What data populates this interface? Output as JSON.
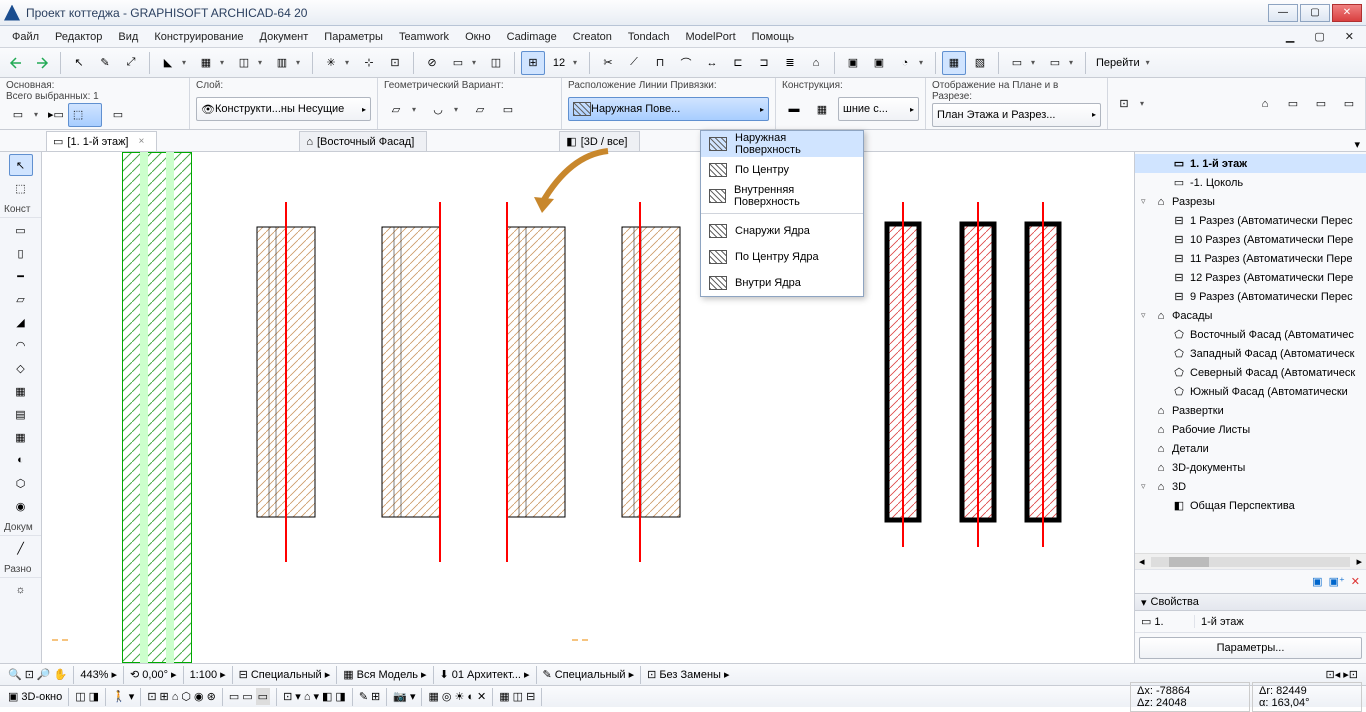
{
  "title": "Проект коттеджа - GRAPHISOFT ARCHICAD-64 20",
  "menu": [
    "Файл",
    "Редактор",
    "Вид",
    "Конструирование",
    "Документ",
    "Параметры",
    "Teamwork",
    "Окно",
    "Cadimage",
    "Creaton",
    "Tondach",
    "ModelPort",
    "Помощь"
  ],
  "goto": "Перейти",
  "infobox": {
    "main_lbl": "Основная:",
    "sel_lbl": "Всего выбранных: 1",
    "layer_lbl": "Слой:",
    "layer_val": "Конструкти...ны Несущие",
    "geom_lbl": "Геометрический Вариант:",
    "refline_lbl": "Расположение Линии Привязки:",
    "refline_val": "Наружная Пове...",
    "constr_lbl": "Конструкция:",
    "constr_val": "шние с...",
    "display_lbl": "Отображение на Плане и в Разрезе:",
    "display_val": "План Этажа и Разрез..."
  },
  "tabs": {
    "t1": "[1. 1-й этаж]",
    "t2": "[Восточный Фасад]",
    "t3": "[3D / все]"
  },
  "toolbox": {
    "hdr1": "Конст",
    "hdr2": "Докум",
    "hdr3": "Разно"
  },
  "popup": {
    "i1": "Наружная Поверхность",
    "i2": "По Центру",
    "i3": "Внутренняя Поверхность",
    "i4": "Снаружи Ядра",
    "i5": "По Центру Ядра",
    "i6": "Внутри Ядра"
  },
  "navigator": {
    "items": [
      {
        "indent": 1,
        "icon": "floor",
        "label": "1. 1-й этаж",
        "sel": true
      },
      {
        "indent": 1,
        "icon": "floor",
        "label": "-1. Цоколь"
      },
      {
        "indent": 0,
        "icon": "group",
        "label": "Разрезы",
        "twist": "▿"
      },
      {
        "indent": 1,
        "icon": "sect",
        "label": "1 Разрез (Автоматически Перес"
      },
      {
        "indent": 1,
        "icon": "sect",
        "label": "10 Разрез (Автоматически Пере"
      },
      {
        "indent": 1,
        "icon": "sect",
        "label": "11 Разрез (Автоматически Пере"
      },
      {
        "indent": 1,
        "icon": "sect",
        "label": "12 Разрез (Автоматически Пере"
      },
      {
        "indent": 1,
        "icon": "sect",
        "label": "9 Разрез (Автоматически Перес"
      },
      {
        "indent": 0,
        "icon": "group",
        "label": "Фасады",
        "twist": "▿"
      },
      {
        "indent": 1,
        "icon": "elev",
        "label": "Восточный Фасад (Автоматичес"
      },
      {
        "indent": 1,
        "icon": "elev",
        "label": "Западный Фасад (Автоматическ"
      },
      {
        "indent": 1,
        "icon": "elev",
        "label": "Северный Фасад (Автоматическ"
      },
      {
        "indent": 1,
        "icon": "elev",
        "label": "Южный Фасад (Автоматически"
      },
      {
        "indent": 0,
        "icon": "group",
        "label": "Развертки"
      },
      {
        "indent": 0,
        "icon": "group",
        "label": "Рабочие Листы"
      },
      {
        "indent": 0,
        "icon": "group",
        "label": "Детали"
      },
      {
        "indent": 0,
        "icon": "group",
        "label": "3D-документы"
      },
      {
        "indent": 0,
        "icon": "group",
        "label": "3D",
        "twist": "▿"
      },
      {
        "indent": 1,
        "icon": "3d",
        "label": "Общая Перспектива"
      }
    ]
  },
  "props": {
    "hdr": "Свойства",
    "id": "1.",
    "name": "1-й этаж",
    "btn": "Параметры..."
  },
  "status1": {
    "zoom": "443%",
    "angle": "0,00°",
    "scale": "1:100",
    "layercomb": "Специальный",
    "model": "Вся Модель",
    "renov": "01 Архитект...",
    "pens": "Специальный",
    "overrides": "Без Замены"
  },
  "status2": {
    "view3d": "3D-окно",
    "dx_lbl": "Δx:",
    "dx": "-78864",
    "dz_lbl": "Δz:",
    "dz": "24048",
    "dr_lbl": "Δr:",
    "dr": "82449",
    "da_lbl": "α:",
    "da": "163,04°"
  }
}
